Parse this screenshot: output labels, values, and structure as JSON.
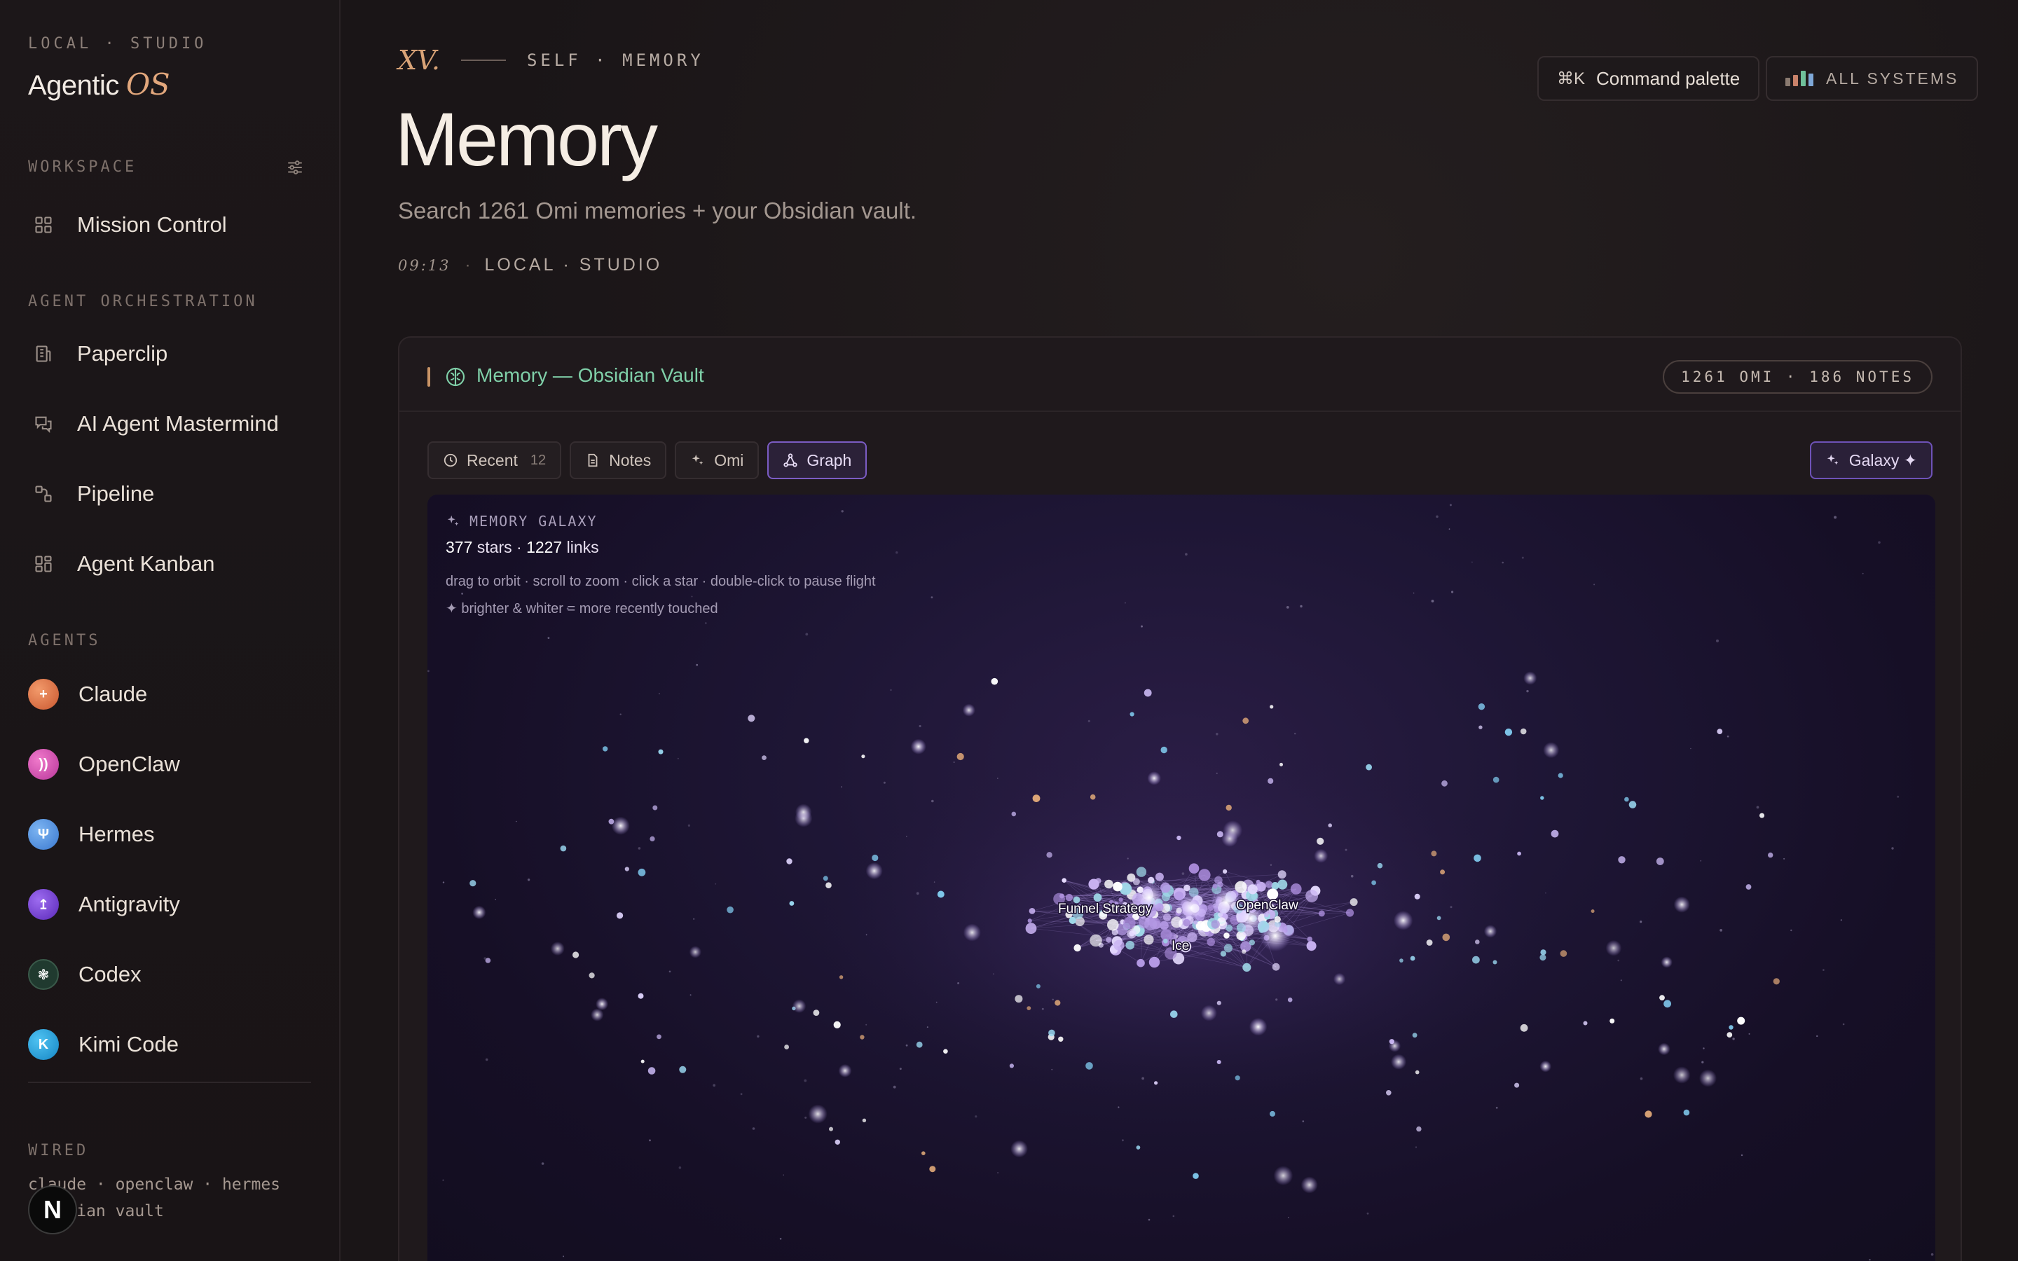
{
  "sidebar": {
    "kicker": "LOCAL · STUDIO",
    "brand_main": "Agentic",
    "brand_accent": "OS",
    "sections": {
      "workspace": "WORKSPACE",
      "orchestration": "AGENT ORCHESTRATION",
      "agents": "AGENTS",
      "wired": "WIRED"
    },
    "workspace_items": [
      {
        "label": "Mission Control",
        "icon": "grid-icon"
      }
    ],
    "orchestration_items": [
      {
        "label": "Paperclip",
        "icon": "building-icon"
      },
      {
        "label": "AI Agent Mastermind",
        "icon": "chat-icon"
      },
      {
        "label": "Pipeline",
        "icon": "pipeline-icon"
      },
      {
        "label": "Agent Kanban",
        "icon": "kanban-icon"
      }
    ],
    "agents": [
      {
        "label": "Claude",
        "glyph": "+",
        "color": "#e07a4f"
      },
      {
        "label": "OpenClaw",
        "glyph": "))",
        "color": "#d94fb2"
      },
      {
        "label": "Hermes",
        "glyph": "Ψ",
        "color": "#4b8fe0"
      },
      {
        "label": "Antigravity",
        "glyph": "↥",
        "color": "#7b3fd6"
      },
      {
        "label": "Codex",
        "glyph": "❃",
        "color": "#1f3a2e"
      },
      {
        "label": "Kimi Code",
        "glyph": "K",
        "color": "#1a9bd8"
      }
    ],
    "wired_line1": "claude · openclaw · hermes",
    "wired_line2": "obsidian vault",
    "badge": "N"
  },
  "header": {
    "roman": "XV.",
    "kicker": "SELF · MEMORY",
    "title": "Memory",
    "subtitle": "Search 1261 Omi memories + your Obsidian vault.",
    "time": "09:13",
    "meta": "LOCAL · STUDIO",
    "command_key": "⌘K",
    "command_label": "Command palette",
    "systems_label": "ALL SYSTEMS"
  },
  "panel": {
    "title": "Memory — Obsidian Vault",
    "counts": "1261 OMI · 186 NOTES",
    "tabs": [
      {
        "label": "Recent",
        "count": "12",
        "icon": "clock-icon"
      },
      {
        "label": "Notes",
        "count": "",
        "icon": "document-icon"
      },
      {
        "label": "Omi",
        "count": "",
        "icon": "sparkles-icon"
      },
      {
        "label": "Graph",
        "count": "",
        "icon": "graph-icon"
      }
    ],
    "active_tab": "Graph",
    "galaxy_button": "Galaxy ✦"
  },
  "galaxy": {
    "kicker": "MEMORY GALAXY",
    "stars": "377",
    "stars_label": "stars",
    "links": "1227",
    "links_label": "links",
    "hint": "drag to orbit · scroll to zoom · click a star · double-click to pause flight",
    "hint2": "✦ brighter & whiter = more recently touched",
    "labels": [
      "Funnel Strategy",
      "OpenClaw",
      "Ice"
    ]
  },
  "colors": {
    "accent_green": "#7fcfa8",
    "accent_copper": "#d9a377",
    "accent_purple": "#7b5cc4"
  }
}
